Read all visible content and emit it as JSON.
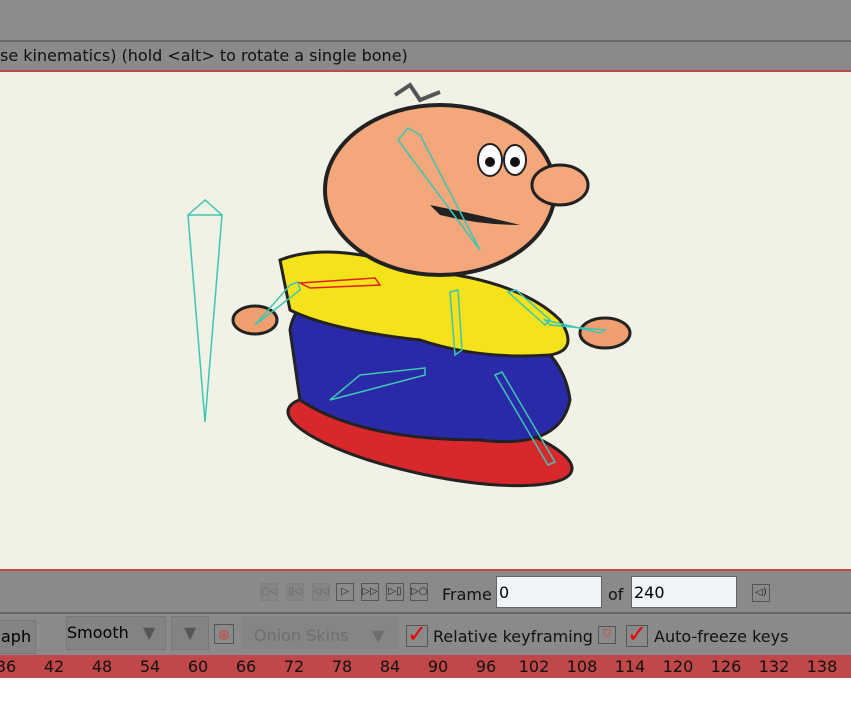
{
  "status_text": "se kinematics) (hold <alt> to rotate a single bone)",
  "playback": {
    "buttons": [
      "rewind-to-start",
      "previous-key",
      "step-back",
      "play",
      "step-forward",
      "next-key",
      "go-to-end"
    ],
    "frame_label": "Frame",
    "frame_value": "0",
    "of_label": "of",
    "total_frames": "240"
  },
  "toolbar": {
    "graph_label": "aph",
    "interpolation": "Smooth",
    "onion_skins": "Onion Skins",
    "relative_keyframing": "Relative keyframing",
    "relative_checked": true,
    "auto_freeze": "Auto-freeze keys",
    "auto_freeze_checked": true
  },
  "timeline": {
    "ticks": [
      "36",
      "42",
      "48",
      "54",
      "60",
      "66",
      "72",
      "78",
      "84",
      "90",
      "96",
      "102",
      "108",
      "114",
      "120",
      "126",
      "132",
      "138"
    ]
  },
  "colors": {
    "accent": "#c0474a",
    "bone": "#3cc6b4",
    "selected_bone": "#e02020"
  }
}
